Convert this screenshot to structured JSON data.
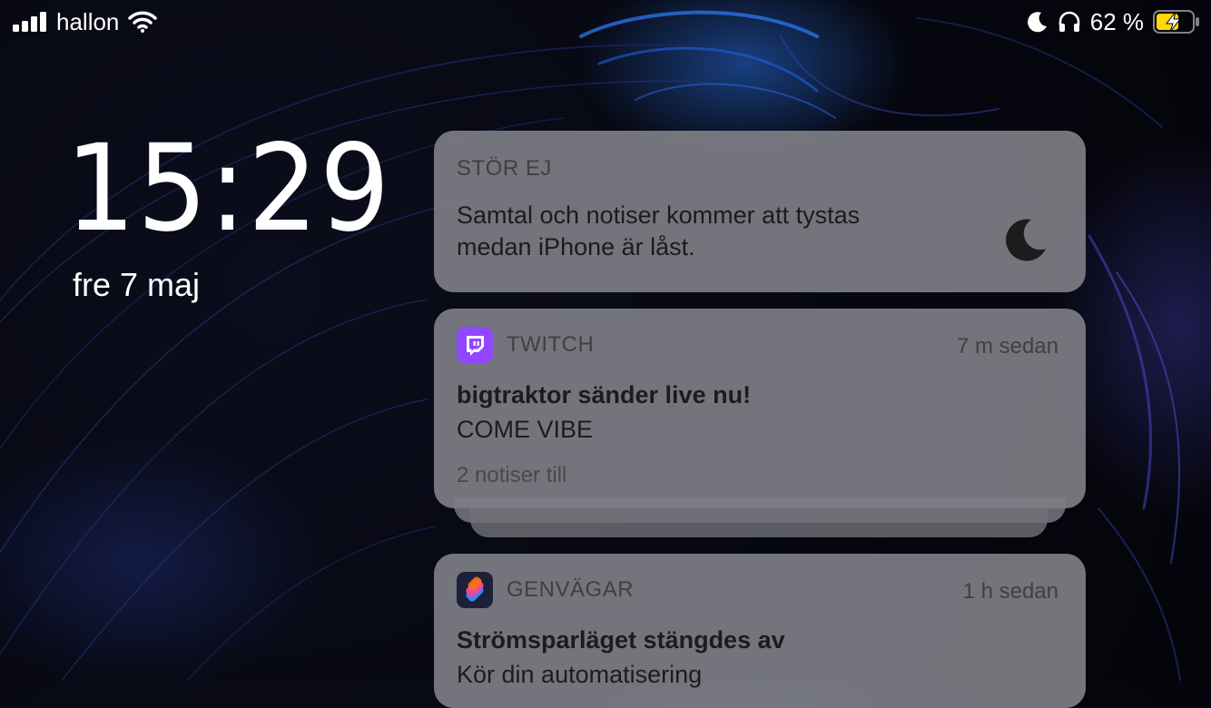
{
  "status_bar": {
    "carrier": "hallon",
    "battery_percent": "62 %",
    "battery_level": 0.62,
    "battery_color": "#ffd60a",
    "icons": [
      "signal-icon",
      "wifi-icon",
      "moon-icon",
      "headphones-icon",
      "battery-charging-icon"
    ]
  },
  "lock_screen": {
    "time": "15:29",
    "date": "fre 7 maj"
  },
  "notifications": [
    {
      "header": "STÖR EJ",
      "body": "Samtal och notiser kommer att tystas\nmedan iPhone är låst.",
      "icon": "moon-icon"
    },
    {
      "app": "TWITCH",
      "app_color": "#9146ff",
      "time": "7 m sedan",
      "title": "bigtraktor sänder live nu!",
      "message": "COME VIBE",
      "more": "2 notiser till",
      "icon": "twitch-icon"
    },
    {
      "app": "GENVÄGAR",
      "time": "1 h sedan",
      "title": "Strömsparläget stängdes av",
      "message": "Kör din automatisering",
      "icon": "shortcuts-icon"
    }
  ]
}
